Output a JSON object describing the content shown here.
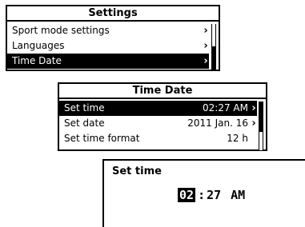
{
  "settings_screen": {
    "title": "Settings",
    "items": [
      {
        "label": "Sport mode settings",
        "chevron": "›",
        "selected": false
      },
      {
        "label": "Languages",
        "chevron": "›",
        "selected": false
      },
      {
        "label": "Time Date",
        "chevron": "›",
        "selected": true
      }
    ]
  },
  "time_date_screen": {
    "title": "Time Date",
    "items": [
      {
        "label": "Set time",
        "value": "02:27 AM",
        "chevron": "›",
        "selected": true
      },
      {
        "label": "Set date",
        "value": "2011 Jan. 16",
        "chevron": "›",
        "selected": false
      },
      {
        "label": "Set time format",
        "value": "12 h",
        "chevron": "",
        "selected": false
      }
    ]
  },
  "set_time_screen": {
    "title": "Set time",
    "hour": "02",
    "separator": ":",
    "minute": "27",
    "ampm": "AM"
  }
}
